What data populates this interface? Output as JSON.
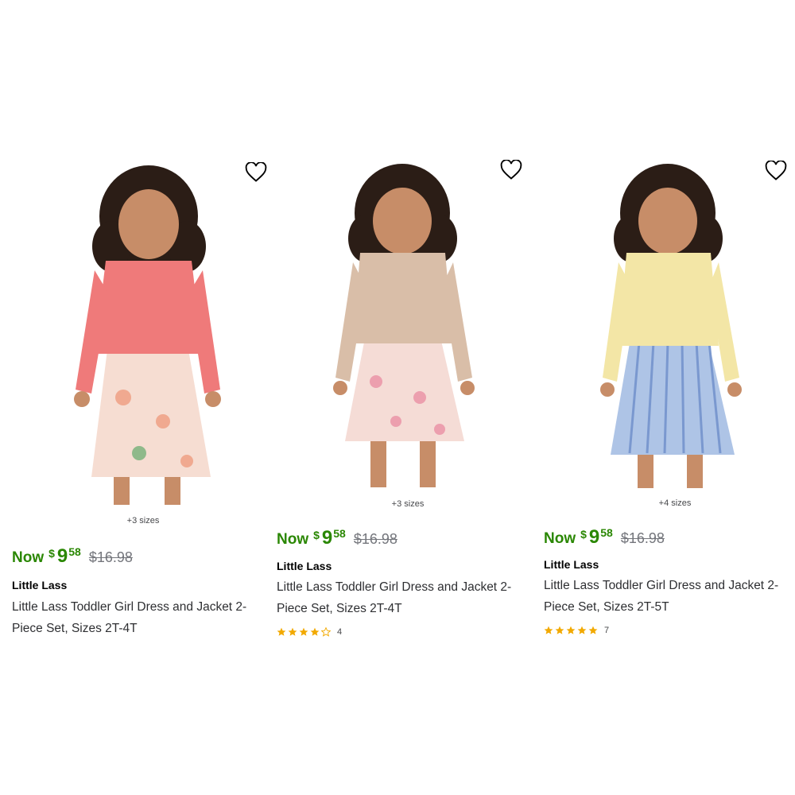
{
  "colors": {
    "price_green": "#2a8703",
    "star_gold": "#f2a900",
    "text": "#2e2f32"
  },
  "products": [
    {
      "sizes_note": "+3 sizes",
      "price": {
        "now_label": "Now",
        "currency": "$",
        "dollars": "9",
        "cents": "58",
        "was": "$16.98"
      },
      "brand": "Little Lass",
      "title": "Little Lass Toddler Girl Dress and Jacket 2-Piece Set, Sizes 2T-4T",
      "jacket_color": "#ef7a7a",
      "rating": null
    },
    {
      "sizes_note": "+3 sizes",
      "price": {
        "now_label": "Now",
        "currency": "$",
        "dollars": "9",
        "cents": "58",
        "was": "$16.98"
      },
      "brand": "Little Lass",
      "title": "Little Lass Toddler Girl Dress and Jacket 2-Piece Set, Sizes 2T-4T",
      "jacket_color": "#d9bea8",
      "rating": {
        "stars": 4,
        "count": "4"
      }
    },
    {
      "sizes_note": "+4 sizes",
      "price": {
        "now_label": "Now",
        "currency": "$",
        "dollars": "9",
        "cents": "58",
        "was": "$16.98"
      },
      "brand": "Little Lass",
      "title": "Little Lass Toddler Girl Dress and Jacket 2-Piece Set, Sizes 2T-5T",
      "jacket_color": "#f3e6a6",
      "rating": {
        "stars": 5,
        "count": "7"
      }
    }
  ]
}
